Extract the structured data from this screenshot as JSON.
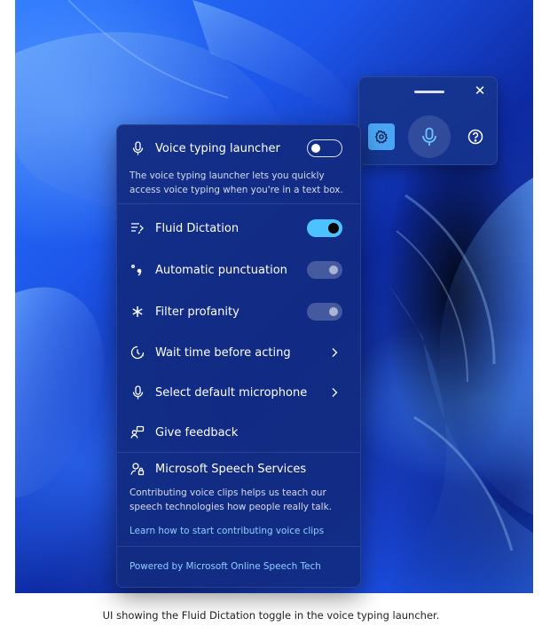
{
  "launcher": {
    "icons": {
      "grip": "drag-handle-icon",
      "close": "close-icon",
      "settings": "gear-icon",
      "mic": "microphone-icon",
      "help": "help-icon"
    },
    "close_glyph": "✕",
    "settings_active": true
  },
  "panel": {
    "voice_launcher": {
      "label": "Voice typing launcher",
      "icon": "microphone-icon",
      "toggle": "off",
      "description": "The voice typing launcher lets you quickly access voice typing when you're in a text box."
    },
    "fluid_dictation": {
      "label": "Fluid Dictation",
      "icon": "fluid-dictation-icon",
      "toggle": "on"
    },
    "auto_punctuation": {
      "label": "Automatic punctuation",
      "icon": "punctuation-icon",
      "toggle": "disabled"
    },
    "filter_profanity": {
      "label": "Filter profanity",
      "icon": "asterisk-icon",
      "toggle": "disabled"
    },
    "wait_time": {
      "label": "Wait time before acting",
      "icon": "timer-icon"
    },
    "default_mic": {
      "label": "Select default microphone",
      "icon": "microphone-icon"
    },
    "feedback": {
      "label": "Give feedback",
      "icon": "feedback-icon"
    },
    "speech_services": {
      "label": "Microsoft Speech Services",
      "icon": "lock-person-icon",
      "description": "Contributing voice clips helps us teach our speech technologies how people really talk.",
      "link": "Learn how to start contributing voice clips"
    },
    "powered_by": "Powered by Microsoft Online Speech Tech"
  },
  "caption": "UI showing the Fluid Dictation toggle in the voice typing launcher.",
  "colors": {
    "accent": "#4cc2ff",
    "link": "#8fd0ff",
    "panel_bg": "#122c82",
    "gear_button": "#4aa6f5"
  }
}
